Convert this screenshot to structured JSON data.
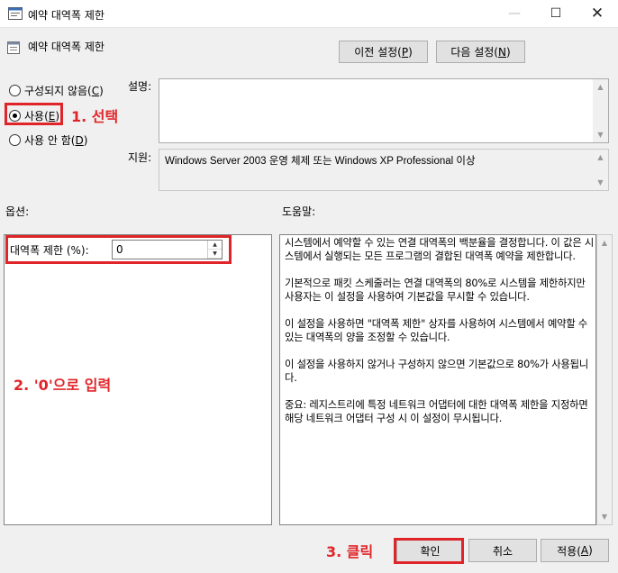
{
  "window": {
    "title": "예약 대역폭 제한"
  },
  "header": {
    "policy_name": "예약 대역폭 제한",
    "prev_label": "이전 설정(",
    "prev_key": "P",
    "next_label": "다음 설정(",
    "next_key": "N"
  },
  "state": {
    "not_configured": {
      "label": "구성되지 않음(",
      "key": "C"
    },
    "enabled": {
      "label": "사용(",
      "key": "E"
    },
    "disabled": {
      "label": "사용 안 함(",
      "key": "D"
    },
    "selected": "enabled"
  },
  "comment": {
    "label": "설명:",
    "value": ""
  },
  "supported": {
    "label": "지원:",
    "value": "Windows Server 2003 운영 체제 또는 Windows XP Professional 이상"
  },
  "options": {
    "label": "옵션:",
    "bandwidth_label": "대역폭 제한 (%):",
    "bandwidth_value": "0"
  },
  "help": {
    "label": "도움말:",
    "text": "시스템에서 예약할 수 있는 연결 대역폭의 백분율을 결정합니다. 이 값은 시스템에서 실행되는 모든 프로그램의 결합된 대역폭 예약을 제한합니다.\n\n기본적으로 패킷 스케줄러는 연결 대역폭의 80%로 시스템을 제한하지만 사용자는 이 설정을 사용하여 기본값을 무시할 수 있습니다.\n\n이 설정을 사용하면 \"대역폭 제한\" 상자를 사용하여 시스템에서 예약할 수 있는 대역폭의 양을 조정할 수 있습니다.\n\n이 설정을 사용하지 않거나 구성하지 않으면 기본값으로 80%가 사용됩니다.\n\n중요: 레지스트리에 특정 네트워크 어댑터에 대한 대역폭 제한을 지정하면 해당 네트워크 어댑터 구성 시 이 설정이 무시됩니다."
  },
  "footer": {
    "ok_label": "확인",
    "cancel_label": "취소",
    "apply_label": "적용(",
    "apply_key": "A"
  },
  "annotations": {
    "step1": "1. 선택",
    "step2": "2. '0'으로 입력",
    "step3": "3. 클릭",
    "color": "#e0252a"
  },
  "icons": {
    "window": "policy-window-icon",
    "minimize": "minimize-icon",
    "maximize": "maximize-icon",
    "close": "close-icon"
  }
}
